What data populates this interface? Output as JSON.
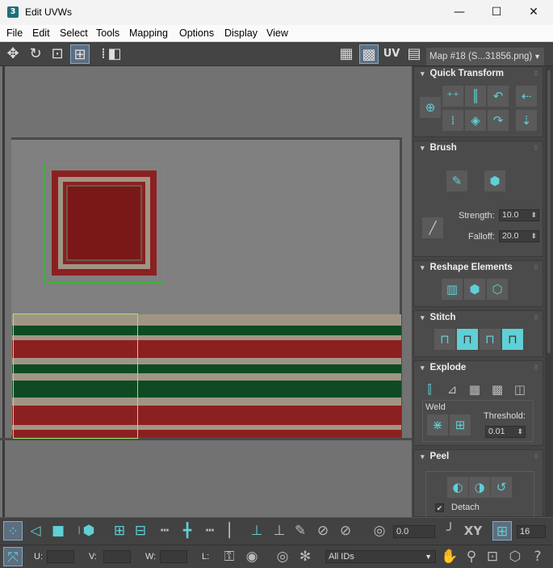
{
  "window": {
    "app_icon": "3",
    "title": "Edit UVWs",
    "controls": {
      "minimize": "—",
      "maximize": "☐",
      "close": "✕"
    }
  },
  "menubar": [
    "File",
    "Edit",
    "Select",
    "Tools",
    "Mapping",
    "Options",
    "Display",
    "View"
  ],
  "toolbar": {
    "uv_label": "UV",
    "map_select": "Map #18 (S...31856.png)"
  },
  "colors": {
    "viewport_bg": "#727272",
    "texture_bg": "#808080",
    "red": "#8c2020",
    "green": "#0e4a24",
    "beige": "#a09585",
    "selection_green": "#27c727",
    "accent_cyan": "#5fd0d6"
  },
  "panel": {
    "quick_transform": {
      "title": "Quick Transform"
    },
    "brush": {
      "title": "Brush",
      "strength_label": "Strength:",
      "strength_value": "10.0",
      "falloff_label": "Falloff:",
      "falloff_value": "20.0"
    },
    "reshape": {
      "title": "Reshape Elements"
    },
    "stitch": {
      "title": "Stitch"
    },
    "explode": {
      "title": "Explode",
      "weld_label": "Weld",
      "threshold_label": "Threshold:",
      "threshold_value": "0.01"
    },
    "peel": {
      "title": "Peel",
      "detach_label": "Detach",
      "detach_checked": "✔"
    }
  },
  "bottom": {
    "angle_value": "0.0",
    "xy_label": "XY",
    "grid_value": "16",
    "u_label": "U:",
    "v_label": "V:",
    "w_label": "W:",
    "l_label": "L:",
    "ids_select": "All IDs"
  }
}
